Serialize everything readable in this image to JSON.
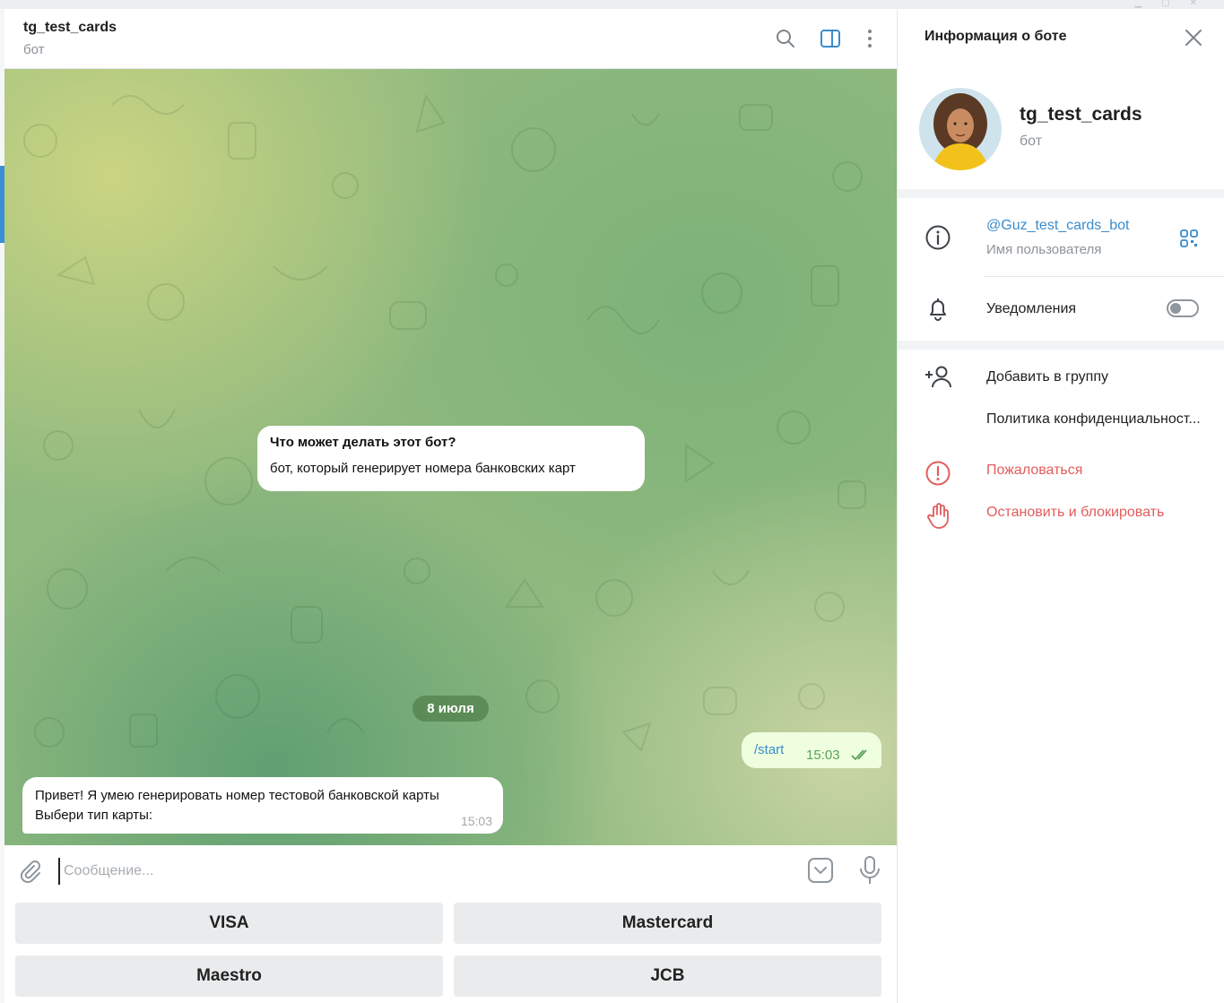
{
  "chat": {
    "title": "tg_test_cards",
    "subtitle": "бот"
  },
  "bot_info_message": {
    "title": "Что может делать этот бот?",
    "body": "бот, который генерирует номера банковских карт"
  },
  "date_separator": "8 июля",
  "outgoing_message": {
    "text": "/start",
    "time": "15:03",
    "status": "read"
  },
  "incoming_message": {
    "line1": "Привет! Я умею генерировать номер тестовой банковской карты",
    "line2": "Выбери тип карты:",
    "time": "15:03"
  },
  "composer": {
    "placeholder": "Сообщение..."
  },
  "keyboard": {
    "buttons": [
      "VISA",
      "Mastercard",
      "Maestro",
      "JCB"
    ]
  },
  "panel": {
    "title": "Информация о боте",
    "name": "tg_test_cards",
    "subtitle": "бот",
    "username": "@Guz_test_cards_bot",
    "username_label": "Имя пользователя",
    "notifications_label": "Уведомления",
    "notifications_on": false,
    "add_to_group": "Добавить в группу",
    "privacy_policy": "Политика конфиденциальност...",
    "report": "Пожаловаться",
    "stop_block": "Остановить и блокировать"
  },
  "colors": {
    "accent": "#3a8ccd",
    "danger": "#e25c5c",
    "outgoing_bubble": "#eefedf"
  }
}
